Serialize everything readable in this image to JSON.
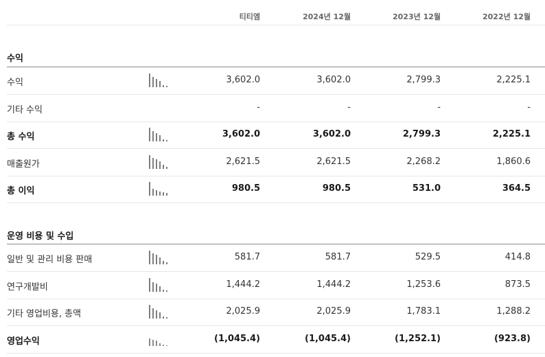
{
  "header": {
    "columns": [
      "티티엠",
      "2024년 12월",
      "2023년 12월",
      "2022년 12월"
    ]
  },
  "sections": [
    {
      "title": "수익",
      "rows": [
        {
          "label": "수익",
          "bold": false,
          "spark": [
            1.0,
            0.75,
            0.6,
            0.45,
            0.15,
            0.1
          ],
          "values": [
            "3,602.0",
            "3,602.0",
            "2,799.3",
            "2,225.1"
          ]
        },
        {
          "label": "기타 수익",
          "bold": false,
          "spark": null,
          "values": [
            "-",
            "-",
            "-",
            "-"
          ]
        },
        {
          "label": "총 수익",
          "bold": true,
          "spark": [
            1.0,
            0.75,
            0.6,
            0.45,
            0.15,
            0.1
          ],
          "values": [
            "3,602.0",
            "3,602.0",
            "2,799.3",
            "2,225.1"
          ]
        },
        {
          "label": "매출원가",
          "bold": false,
          "spark": [
            1.0,
            0.8,
            0.7,
            0.55,
            0.3,
            0.15
          ],
          "values": [
            "2,621.5",
            "2,621.5",
            "2,268.2",
            "1,860.6"
          ]
        },
        {
          "label": "총 이익",
          "bold": true,
          "spark": [
            1.0,
            0.5,
            0.4,
            0.3,
            0.25,
            0.2
          ],
          "values": [
            "980.5",
            "980.5",
            "531.0",
            "364.5"
          ]
        }
      ]
    },
    {
      "title": "운영 비용 및 수입",
      "rows": [
        {
          "label": "일반 및 관리 비용 판매",
          "bold": false,
          "spark": [
            1.0,
            0.8,
            0.7,
            0.5,
            0.25,
            0.15
          ],
          "values": [
            "581.7",
            "581.7",
            "529.5",
            "414.8"
          ]
        },
        {
          "label": "연구개발비",
          "bold": false,
          "spark": [
            1.0,
            0.7,
            0.6,
            0.4,
            0.15,
            0.1
          ],
          "values": [
            "1,444.2",
            "1,444.2",
            "1,253.6",
            "873.5"
          ]
        },
        {
          "label": "기타 영업비용, 총액",
          "bold": false,
          "spark": [
            1.0,
            0.75,
            0.6,
            0.45,
            0.15,
            0.1
          ],
          "values": [
            "2,025.9",
            "2,025.9",
            "1,783.1",
            "1,288.2"
          ]
        },
        {
          "label": "영업수익",
          "bold": true,
          "spark": [
            0.55,
            0.45,
            0.4,
            0.2,
            0.1,
            0.05
          ],
          "values": [
            "(1,045.4)",
            "(1,045.4)",
            "(1,252.1)",
            "(923.8)"
          ]
        }
      ]
    }
  ]
}
